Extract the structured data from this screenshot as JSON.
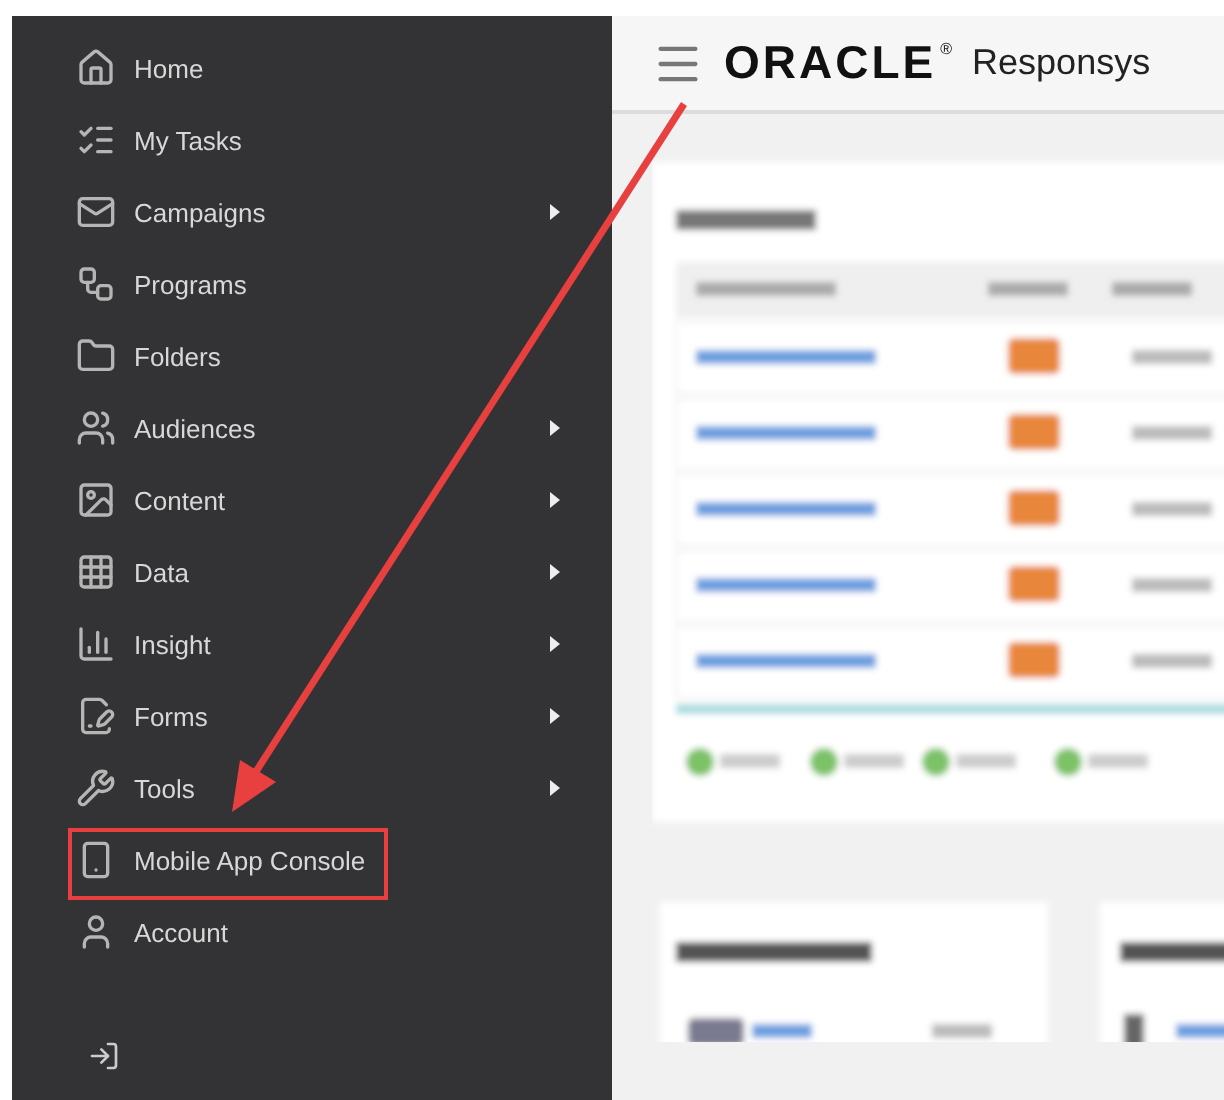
{
  "sidebar": {
    "items": [
      {
        "label": "Home",
        "submenu": false,
        "highlighted": false
      },
      {
        "label": "My Tasks",
        "submenu": false,
        "highlighted": false
      },
      {
        "label": "Campaigns",
        "submenu": true,
        "highlighted": false
      },
      {
        "label": "Programs",
        "submenu": false,
        "highlighted": false
      },
      {
        "label": "Folders",
        "submenu": false,
        "highlighted": false
      },
      {
        "label": "Audiences",
        "submenu": true,
        "highlighted": false
      },
      {
        "label": "Content",
        "submenu": true,
        "highlighted": false
      },
      {
        "label": "Data",
        "submenu": true,
        "highlighted": false
      },
      {
        "label": "Insight",
        "submenu": true,
        "highlighted": false
      },
      {
        "label": "Forms",
        "submenu": true,
        "highlighted": false
      },
      {
        "label": "Tools",
        "submenu": true,
        "highlighted": false
      },
      {
        "label": "Mobile App Console",
        "submenu": false,
        "highlighted": true
      },
      {
        "label": "Account",
        "submenu": false,
        "highlighted": false
      }
    ]
  },
  "header": {
    "brand": "ORACLE",
    "registered": "®",
    "product": "Responsys"
  }
}
